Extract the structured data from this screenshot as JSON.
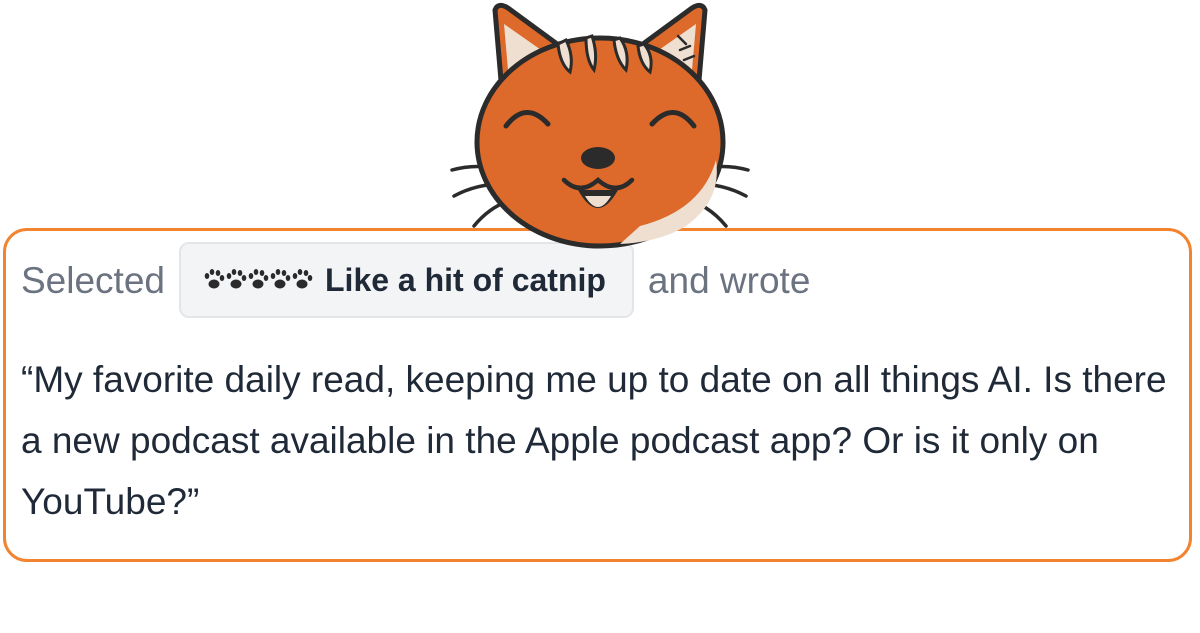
{
  "review": {
    "selected_prefix": "Selected",
    "rating_label": "Like a hit of catnip",
    "rating_paws": 5,
    "wrote_suffix": "and wrote",
    "text": "“My favorite daily read, keeping me up to date on all things AI. Is there a new podcast available in the Apple podcast app? Or is it only on YouTube?”"
  },
  "mascot": {
    "icon": "smiling-cat-face-icon"
  },
  "colors": {
    "card_border": "#f2832f",
    "cat_fur": "#dd6a2a",
    "muted_text": "#6b7280",
    "body_text": "#1f2937",
    "chip_background": "#f3f4f6"
  }
}
